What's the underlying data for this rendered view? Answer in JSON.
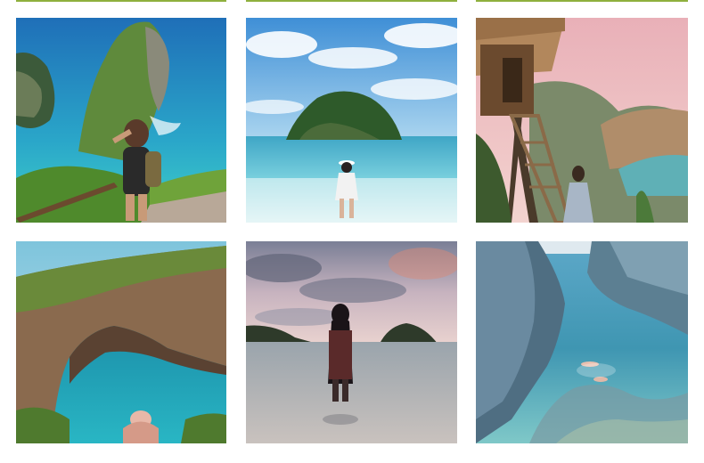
{
  "gallery": {
    "accent_color": "#8fb03e",
    "columns": 3,
    "rows": 2,
    "photos": [
      {
        "subject": "woman-on-cliff-overlooking-sea-stack-and-turquoise-bay"
      },
      {
        "subject": "woman-in-white-dress-wading-toward-small-rocky-island"
      },
      {
        "subject": "treehouse-with-wooden-ladder-above-coastal-cliffs"
      },
      {
        "subject": "natural-rock-arch-over-turquoise-pool"
      },
      {
        "subject": "woman-silhouette-standing-in-sea-at-dusk"
      },
      {
        "subject": "people-swimming-in-narrow-rocky-ocean-channel"
      }
    ]
  }
}
